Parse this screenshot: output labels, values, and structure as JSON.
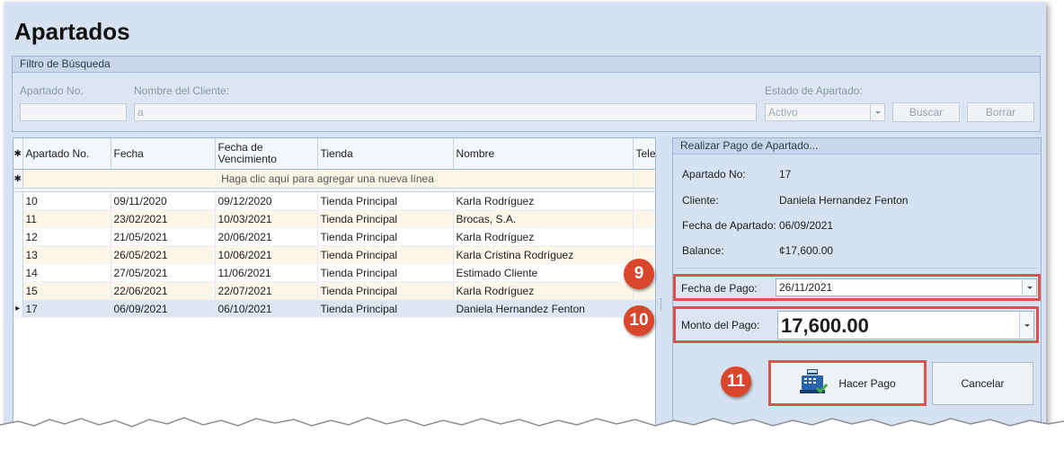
{
  "page": {
    "title": "Apartados"
  },
  "filter": {
    "header": "Filtro de Búsqueda",
    "apartado_label": "Apartado No.",
    "apartado_value": "",
    "cliente_label": "Nombre del Cliente:",
    "cliente_value": "a",
    "estado_label": "Estado de Apartado:",
    "estado_value": "Activo",
    "buscar_label": "Buscar",
    "borrar_label": "Borrar"
  },
  "grid": {
    "columns": [
      "Apartado No.",
      "Fecha",
      "Fecha de Vencimiento",
      "Tienda",
      "Nombre",
      "Tele"
    ],
    "new_row_hint": "Haga clic aquí para agregar una nueva línea",
    "rows": [
      {
        "no": "10",
        "fecha": "09/11/2020",
        "vence": "09/12/2020",
        "tienda": "Tienda Principal",
        "nombre": "Karla Rodríguez"
      },
      {
        "no": "11",
        "fecha": "23/02/2021",
        "vence": "10/03/2021",
        "tienda": "Tienda Principal",
        "nombre": "Brocas, S.A."
      },
      {
        "no": "12",
        "fecha": "21/05/2021",
        "vence": "20/06/2021",
        "tienda": "Tienda Principal",
        "nombre": "Karla Rodríguez"
      },
      {
        "no": "13",
        "fecha": "26/05/2021",
        "vence": "10/06/2021",
        "tienda": "Tienda Principal",
        "nombre": "Karla Cristina Rodríguez"
      },
      {
        "no": "14",
        "fecha": "27/05/2021",
        "vence": "11/06/2021",
        "tienda": "Tienda Principal",
        "nombre": "Estimado Cliente"
      },
      {
        "no": "15",
        "fecha": "22/06/2021",
        "vence": "22/07/2021",
        "tienda": "Tienda Principal",
        "nombre": "Karla Rodríguez"
      },
      {
        "no": "17",
        "fecha": "06/09/2021",
        "vence": "06/10/2021",
        "tienda": "Tienda Principal",
        "nombre": "Daniela Hernandez Fenton"
      }
    ]
  },
  "payment": {
    "header": "Realizar Pago de Apartado...",
    "apartado_label": "Apartado No:",
    "apartado_value": "17",
    "cliente_label": "Cliente:",
    "cliente_value": "Daniela Hernandez Fenton",
    "fecha_apartado_label": "Fecha de Apartado:",
    "fecha_apartado_value": "06/09/2021",
    "balance_label": "Balance:",
    "balance_value": "¢17,600.00",
    "fecha_pago_label": "Fecha de Pago:",
    "fecha_pago_value": "26/11/2021",
    "monto_label": "Monto del Pago:",
    "monto_value": "17,600.00",
    "hacer_pago_label": "Hacer Pago",
    "cancelar_label": "Cancelar"
  },
  "callouts": {
    "c9": "9",
    "c10": "10",
    "c11": "11"
  },
  "colors": {
    "callout": "#d9462c",
    "highlight_border": "#d9534f",
    "window_bg": "#d6e2f1"
  }
}
